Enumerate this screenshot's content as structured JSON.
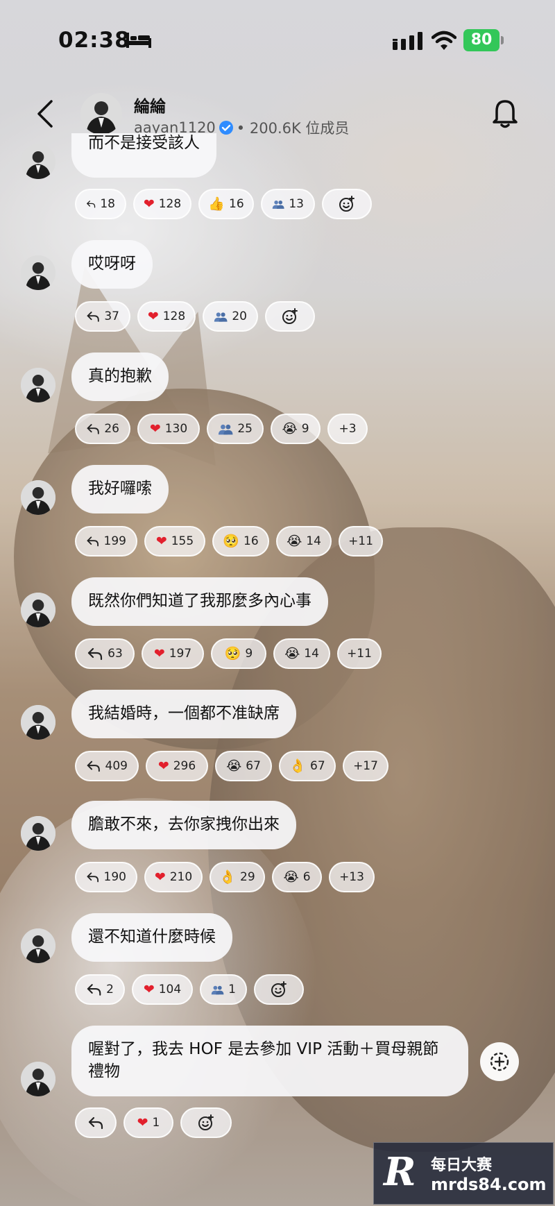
{
  "status_bar": {
    "time": "02:38",
    "battery": "80"
  },
  "header": {
    "name": "綸綸",
    "username": "aayan1120",
    "members": "• 200.6K 位成员"
  },
  "messages": [
    {
      "text": "而不是接受該人",
      "reactions": [
        {
          "icon": "reply-icon",
          "count": "18"
        },
        {
          "icon": "heart-icon",
          "emoji": "❤",
          "count": "128"
        },
        {
          "icon": "thumbs-up-icon",
          "emoji": "👍",
          "count": "16"
        },
        {
          "icon": "people-icon",
          "count": "13"
        },
        {
          "icon": "add-reaction-icon"
        }
      ]
    },
    {
      "text": "哎呀呀",
      "reactions": [
        {
          "icon": "reply-icon",
          "count": "37"
        },
        {
          "icon": "heart-icon",
          "emoji": "❤",
          "count": "128"
        },
        {
          "icon": "people-icon",
          "count": "20"
        },
        {
          "icon": "add-reaction-icon"
        }
      ]
    },
    {
      "text": "真的抱歉",
      "reactions": [
        {
          "icon": "reply-icon",
          "count": "26"
        },
        {
          "icon": "heart-icon",
          "emoji": "❤",
          "count": "130"
        },
        {
          "icon": "people-icon",
          "count": "25"
        },
        {
          "icon": "crying-face-icon",
          "emoji": "😭",
          "count": "9"
        },
        {
          "icon": "more-count",
          "count": "+3"
        }
      ]
    },
    {
      "text": "我好囉嗦",
      "reactions": [
        {
          "icon": "reply-icon",
          "count": "199"
        },
        {
          "icon": "heart-icon",
          "emoji": "❤",
          "count": "155"
        },
        {
          "icon": "pleading-face-icon",
          "emoji": "🥺",
          "count": "16"
        },
        {
          "icon": "crying-face-icon",
          "emoji": "😭",
          "count": "14"
        },
        {
          "icon": "more-count",
          "count": "+11"
        }
      ]
    },
    {
      "text": "既然你們知道了我那麼多內心事",
      "reactions": [
        {
          "icon": "reply-icon",
          "count": "63"
        },
        {
          "icon": "heart-icon",
          "emoji": "❤",
          "count": "197"
        },
        {
          "icon": "pleading-face-icon",
          "emoji": "🥺",
          "count": "9"
        },
        {
          "icon": "crying-face-icon",
          "emoji": "😭",
          "count": "14"
        },
        {
          "icon": "more-count",
          "count": "+11"
        }
      ]
    },
    {
      "text": "我結婚時，一個都不准缺席",
      "reactions": [
        {
          "icon": "reply-icon",
          "count": "409"
        },
        {
          "icon": "heart-icon",
          "emoji": "❤",
          "count": "296"
        },
        {
          "icon": "crying-face-icon",
          "emoji": "😭",
          "count": "67"
        },
        {
          "icon": "ok-hand-icon",
          "emoji": "👌",
          "count": "67"
        },
        {
          "icon": "more-count",
          "count": "+17"
        }
      ]
    },
    {
      "text": "膽敢不來，去你家拽你出來",
      "reactions": [
        {
          "icon": "reply-icon",
          "count": "190"
        },
        {
          "icon": "heart-icon",
          "emoji": "❤",
          "count": "210"
        },
        {
          "icon": "ok-hand-icon",
          "emoji": "👌",
          "count": "29"
        },
        {
          "icon": "crying-face-icon",
          "emoji": "😭",
          "count": "6"
        },
        {
          "icon": "more-count",
          "count": "+13"
        }
      ]
    },
    {
      "text": "還不知道什麼時候",
      "reactions": [
        {
          "icon": "reply-icon",
          "count": "2"
        },
        {
          "icon": "heart-icon",
          "emoji": "❤",
          "count": "104"
        },
        {
          "icon": "people-icon",
          "count": "1"
        },
        {
          "icon": "add-reaction-icon"
        }
      ]
    },
    {
      "text": "喔對了，我去 HOF 是去參加 VIP 活動＋買母親節禮物",
      "reactions": [
        {
          "icon": "reply-icon"
        },
        {
          "icon": "heart-icon",
          "emoji": "❤",
          "count": "1"
        },
        {
          "icon": "add-reaction-icon"
        }
      ]
    }
  ],
  "watermark": {
    "logo": "R",
    "title": "每日大赛",
    "url": "mrds84.com"
  },
  "colors": {
    "battery": "#33c759",
    "verified": "#2f8cff",
    "heart": "#e2202d"
  }
}
